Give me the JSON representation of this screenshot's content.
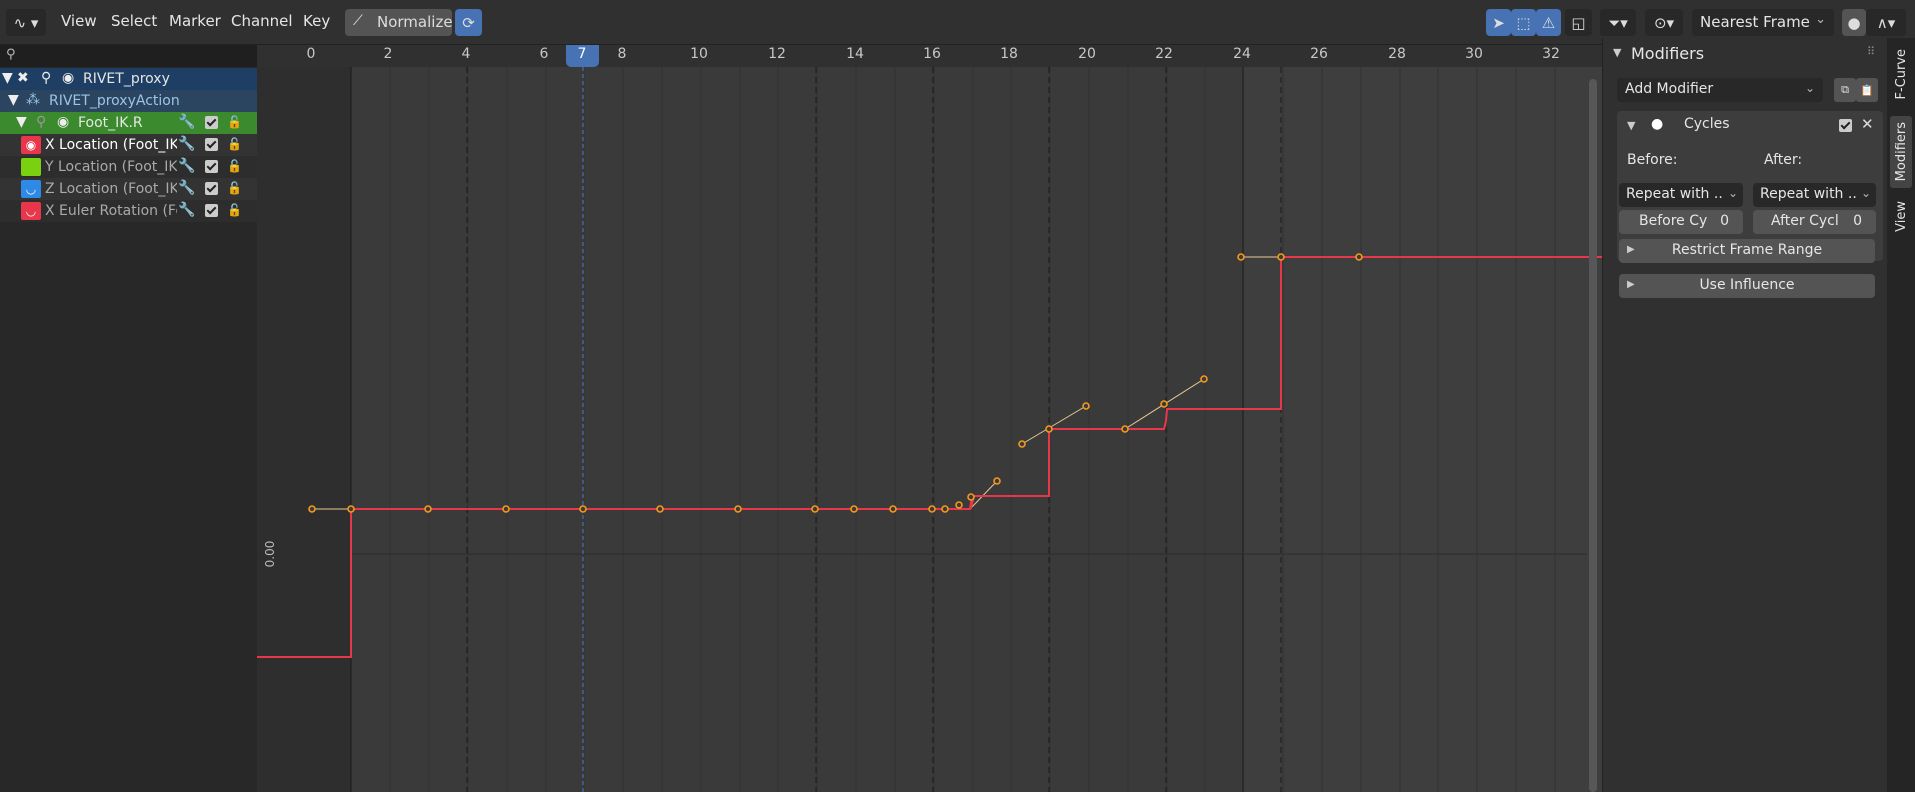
{
  "header": {
    "menus": [
      "View",
      "Select",
      "Marker",
      "Channel",
      "Key"
    ],
    "normalize_label": "Normalize",
    "snap_mode": "Nearest Frame"
  },
  "channels": {
    "object": "RIVET_proxy",
    "action": "RIVET_proxyAction",
    "group": "Foot_IK.R",
    "curves": [
      {
        "label": "X Location (Foot_IK.R)",
        "color": "#e8374a"
      },
      {
        "label": "Y Location (Foot_IK.R)",
        "color": "#79d10f"
      },
      {
        "label": "Z Location (Foot_IK.R)",
        "color": "#2e8ae6"
      },
      {
        "label": "X Euler Rotation (Foot_IK.R)",
        "color": "#e8374a"
      }
    ]
  },
  "timeline": {
    "ticks": [
      "0",
      "2",
      "4",
      "6",
      "8",
      "10",
      "12",
      "14",
      "16",
      "18",
      "20",
      "22",
      "24",
      "26",
      "28",
      "30",
      "32"
    ],
    "current_frame": "7",
    "value_label": "0.00"
  },
  "modifiers": {
    "title": "Modifiers",
    "add_modifier": "Add Modifier",
    "cycles": {
      "name": "Cycles",
      "before_label": "Before:",
      "after_label": "After:",
      "before_mode": "Repeat with ..",
      "after_mode": "Repeat with ..",
      "before_cycles_label": "Before Cy",
      "before_cycles_value": "0",
      "after_cycles_label": "After Cycl",
      "after_cycles_value": "0"
    },
    "restrict_frame_range": "Restrict Frame Range",
    "use_influence": "Use Influence"
  },
  "side_tabs": [
    "F-Curve",
    "Modifiers",
    "View"
  ],
  "colors": {
    "curve": "#e8374a",
    "keyframe": "#f39a1a",
    "playhead": "#4772b3",
    "group": "#3b8a2e"
  }
}
